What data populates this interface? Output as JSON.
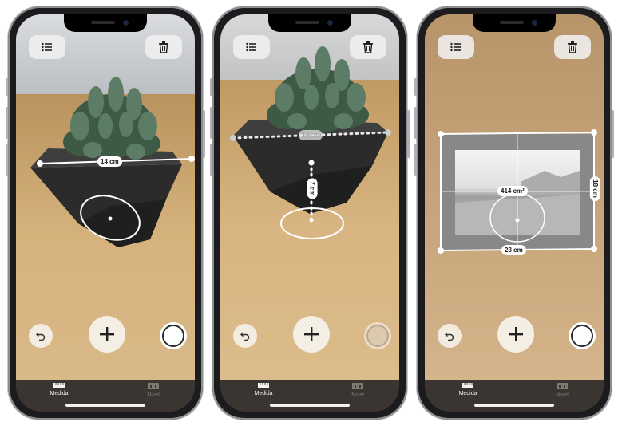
{
  "tabs": [
    {
      "label": "Medida"
    },
    {
      "label": "Nivel"
    }
  ],
  "phones": [
    {
      "measurement_label": "14 cm"
    },
    {
      "horizontal_label": "14 cm",
      "vertical_label": "7 cm"
    },
    {
      "area_label": "414 cm²",
      "height_label": "18 cm",
      "width_label": "23 cm"
    }
  ],
  "icons": {
    "list": "list-icon",
    "trash": "trash-icon",
    "undo": "undo-icon",
    "add": "plus-icon",
    "capture": "shutter-icon",
    "measure_tab": "ruler-icon",
    "level_tab": "level-icon"
  },
  "colors": {
    "tab_bar": "#3a3530",
    "active_tab": "#f2f2f2",
    "inactive_tab": "#7e7a74"
  }
}
